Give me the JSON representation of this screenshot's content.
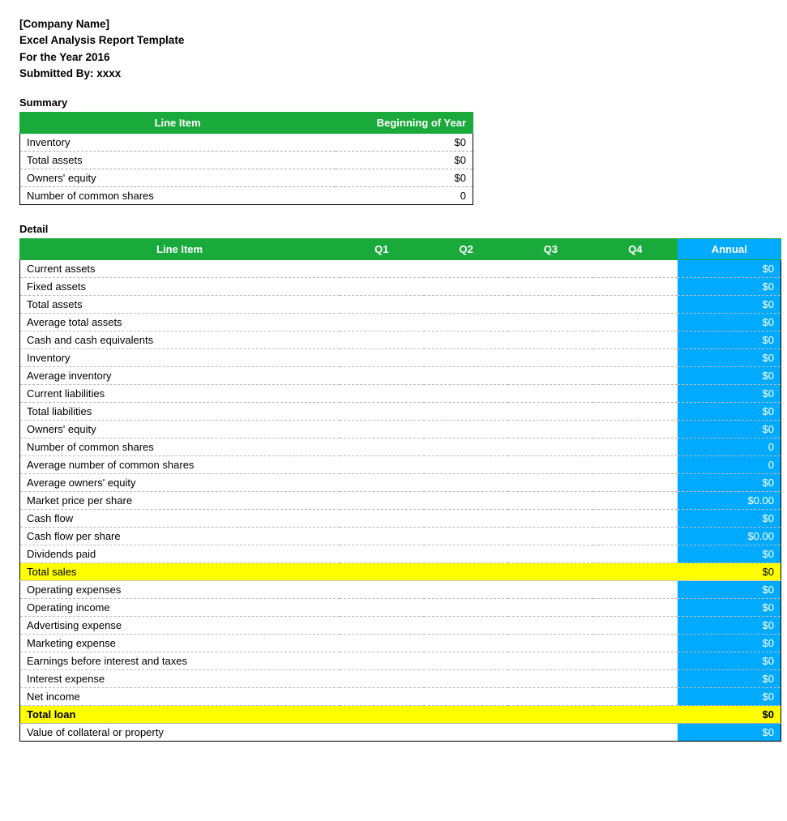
{
  "header": {
    "line1": "[Company Name]",
    "line2": "Excel Analysis Report Template",
    "line3": "For the Year 2016",
    "line4": "Submitted By:  xxxx"
  },
  "summary": {
    "label": "Summary",
    "columns": {
      "line_item": "Line Item",
      "beginning_of_year": "Beginning of Year"
    },
    "rows": [
      {
        "label": "Inventory",
        "value": "$0"
      },
      {
        "label": "Total assets",
        "value": "$0"
      },
      {
        "label": "Owners' equity",
        "value": "$0"
      },
      {
        "label": "Number of common shares",
        "value": "0"
      }
    ]
  },
  "detail": {
    "label": "Detail",
    "columns": {
      "line_item": "Line Item",
      "q1": "Q1",
      "q2": "Q2",
      "q3": "Q3",
      "q4": "Q4",
      "annual": "Annual"
    },
    "rows": [
      {
        "label": "Current assets",
        "q1": "",
        "q2": "",
        "q3": "",
        "q4": "",
        "annual": "$0",
        "type": "normal"
      },
      {
        "label": "Fixed assets",
        "q1": "",
        "q2": "",
        "q3": "",
        "q4": "",
        "annual": "$0",
        "type": "normal"
      },
      {
        "label": "Total assets",
        "q1": "",
        "q2": "",
        "q3": "",
        "q4": "",
        "annual": "$0",
        "type": "normal"
      },
      {
        "label": "Average total assets",
        "q1": "",
        "q2": "",
        "q3": "",
        "q4": "",
        "annual": "$0",
        "type": "normal"
      },
      {
        "label": "Cash and cash equivalents",
        "q1": "",
        "q2": "",
        "q3": "",
        "q4": "",
        "annual": "$0",
        "type": "normal"
      },
      {
        "label": "Inventory",
        "q1": "",
        "q2": "",
        "q3": "",
        "q4": "",
        "annual": "$0",
        "type": "normal"
      },
      {
        "label": "Average inventory",
        "q1": "",
        "q2": "",
        "q3": "",
        "q4": "",
        "annual": "$0",
        "type": "normal"
      },
      {
        "label": "Current liabilities",
        "q1": "",
        "q2": "",
        "q3": "",
        "q4": "",
        "annual": "$0",
        "type": "normal"
      },
      {
        "label": "Total liabilities",
        "q1": "",
        "q2": "",
        "q3": "",
        "q4": "",
        "annual": "$0",
        "type": "normal"
      },
      {
        "label": "Owners' equity",
        "q1": "",
        "q2": "",
        "q3": "",
        "q4": "",
        "annual": "$0",
        "type": "normal"
      },
      {
        "label": "Number of common shares",
        "q1": "",
        "q2": "",
        "q3": "",
        "q4": "",
        "annual": "0",
        "type": "normal"
      },
      {
        "label": "Average number of common shares",
        "q1": "",
        "q2": "",
        "q3": "",
        "q4": "",
        "annual": "0",
        "type": "normal"
      },
      {
        "label": "Average owners' equity",
        "q1": "",
        "q2": "",
        "q3": "",
        "q4": "",
        "annual": "$0",
        "type": "normal"
      },
      {
        "label": "Market price per share",
        "q1": "",
        "q2": "",
        "q3": "",
        "q4": "",
        "annual": "$0.00",
        "type": "normal"
      },
      {
        "label": "Cash flow",
        "q1": "",
        "q2": "",
        "q3": "",
        "q4": "",
        "annual": "$0",
        "type": "normal"
      },
      {
        "label": "Cash flow per share",
        "q1": "",
        "q2": "",
        "q3": "",
        "q4": "",
        "annual": "$0.00",
        "type": "normal"
      },
      {
        "label": "Dividends paid",
        "q1": "",
        "q2": "",
        "q3": "",
        "q4": "",
        "annual": "$0",
        "type": "normal"
      },
      {
        "label": "Total sales",
        "q1": "",
        "q2": "",
        "q3": "",
        "q4": "",
        "annual": "$0",
        "type": "yellow"
      },
      {
        "label": "Operating expenses",
        "q1": "",
        "q2": "",
        "q3": "",
        "q4": "",
        "annual": "$0",
        "type": "normal"
      },
      {
        "label": "Operating income",
        "q1": "",
        "q2": "",
        "q3": "",
        "q4": "",
        "annual": "$0",
        "type": "normal"
      },
      {
        "label": "Advertising expense",
        "q1": "",
        "q2": "",
        "q3": "",
        "q4": "",
        "annual": "$0",
        "type": "normal"
      },
      {
        "label": "Marketing expense",
        "q1": "",
        "q2": "",
        "q3": "",
        "q4": "",
        "annual": "$0",
        "type": "normal"
      },
      {
        "label": "Earnings before interest and taxes",
        "q1": "",
        "q2": "",
        "q3": "",
        "q4": "",
        "annual": "$0",
        "type": "normal"
      },
      {
        "label": "Interest expense",
        "q1": "",
        "q2": "",
        "q3": "",
        "q4": "",
        "annual": "$0",
        "type": "normal"
      },
      {
        "label": "Net income",
        "q1": "",
        "q2": "",
        "q3": "",
        "q4": "",
        "annual": "$0",
        "type": "normal"
      },
      {
        "label": "Total loan",
        "q1": "",
        "q2": "",
        "q3": "",
        "q4": "",
        "annual": "$0",
        "type": "yellow-bold"
      },
      {
        "label": "Value of collateral or property",
        "q1": "",
        "q2": "",
        "q3": "",
        "q4": "",
        "annual": "$0",
        "type": "normal"
      }
    ]
  }
}
